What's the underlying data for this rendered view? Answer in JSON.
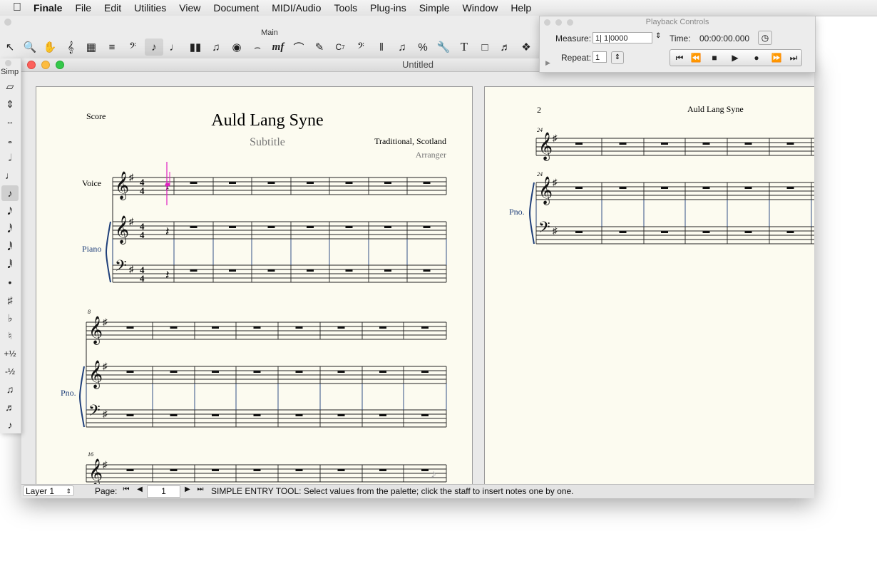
{
  "menubar": {
    "app_name": "Finale",
    "items": [
      "File",
      "Edit",
      "Utilities",
      "View",
      "Document",
      "MIDI/Audio",
      "Tools",
      "Plug-ins",
      "Simple",
      "Window",
      "Help"
    ]
  },
  "main_toolbar": {
    "title": "Main",
    "tools": [
      "selection-tool-icon",
      "zoom-tool-icon",
      "hand-grabber-icon",
      "staff-tool-icon",
      "key-signature-icon",
      "time-signature-icon",
      "clef-tool-icon",
      "simple-entry-icon",
      "speedy-entry-icon",
      "hyperscribe-icon",
      "tuplet-tool-icon",
      "smart-shape-icon",
      "articulation-icon",
      "expression-icon",
      "ornament-icon",
      "repeat-tool-icon",
      "lyrics-tool-icon",
      "chord-tool-icon",
      "mirror-tool-icon",
      "measure-tool-icon",
      "graphics-tool-icon",
      "resize-tool-icon",
      "special-tools-icon",
      "text-tool-icon",
      "page-layout-icon",
      "ossia-icon",
      "mixer-icon"
    ]
  },
  "simple_palette": {
    "title": "Simp",
    "items": [
      "eraser-icon",
      "selector-icon",
      "tie-icon",
      "whole-note-icon",
      "half-note-icon",
      "quarter-note-icon",
      "eighth-note-icon",
      "sixteenth-note-icon",
      "thirty-second-note-icon",
      "sixty-fourth-note-icon",
      "one-twenty-eighth-note-icon",
      "dot-icon",
      "sharp-icon",
      "flat-icon",
      "natural-icon",
      "raise-half-icon",
      "lower-half-icon",
      "tie-notes-icon",
      "tuplet-icon",
      "grace-note-icon"
    ],
    "plus_half": "+½",
    "minus_half": "-½"
  },
  "document": {
    "window_title": "Untitled",
    "page1": {
      "part_label": "Score",
      "title": "Auld Lang Syne",
      "subtitle": "Subtitle",
      "composer": "Traditional, Scotland",
      "arranger": "Arranger",
      "voice_label": "Voice",
      "piano_label": "Piano",
      "pno_label": "Pno.",
      "measure_numbers": [
        "8",
        "16"
      ]
    },
    "page2": {
      "page_number": "2",
      "header_title": "Auld Lang Syne",
      "pno_label": "Pno.",
      "measure_number": "24"
    }
  },
  "status_bar": {
    "layer": "Layer 1",
    "page_label": "Page:",
    "page_value": "1",
    "message": "SIMPLE ENTRY TOOL: Select values from the palette; click the staff to insert notes one by one."
  },
  "playback_controls": {
    "title": "Playback Controls",
    "measure_label": "Measure:",
    "measure_value": "1| 1|0000",
    "time_label": "Time:",
    "time_value": "00:00:00.000",
    "repeat_label": "Repeat:",
    "repeat_value": "1"
  },
  "colors": {
    "page_bg": "#fcfbf0",
    "cursor": "#e020c0",
    "label_blue": "#1f3f7a"
  }
}
